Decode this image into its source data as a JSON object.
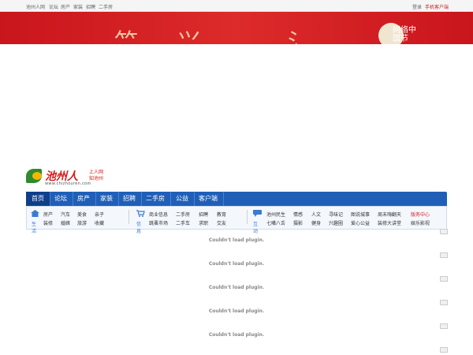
{
  "topbar": {
    "links": [
      "池州人网",
      "论坛",
      "房产",
      "家装",
      "招聘",
      "二手房"
    ],
    "login": "登录",
    "mobile": "手机客户端"
  },
  "banner": {
    "festival": "网络中国节"
  },
  "logo": {
    "name": "池州人",
    "slogan_line1": "上人网",
    "slogan_line2": "知池州",
    "url": "www.chizhouren.com"
  },
  "nav": {
    "items": [
      "首页",
      "论坛",
      "房产",
      "家装",
      "招聘",
      "二手房",
      "公益",
      "客户端"
    ]
  },
  "subnav": {
    "life": {
      "label": "生活",
      "row1": [
        "房产",
        "汽车",
        "美食",
        "亲子"
      ],
      "row2": [
        "装修",
        "婚嫁",
        "旅游",
        "收藏"
      ]
    },
    "info": {
      "label": "信息",
      "row1": [
        "商业信息",
        "二手房",
        "招聘",
        "教育"
      ],
      "row2": [
        "跳蚤市场",
        "二手车",
        "求职",
        "交友"
      ]
    },
    "interact": {
      "label": "互动",
      "row1": [
        "池州民生",
        "情感",
        "人文",
        "寻味记",
        "图说城事",
        "周末嗨翻天",
        "版务中心"
      ],
      "row2": [
        "七嘴八舌",
        "摄影",
        "健身",
        "兴趣圈",
        "爱心公益",
        "装修大讲堂",
        "娱乐影视"
      ]
    }
  },
  "plugin_message": "Couldn't load plugin.",
  "colors": {
    "nav": "#1f5fb8",
    "brand_red": "#d41b1b",
    "banner": "#c9151c"
  }
}
